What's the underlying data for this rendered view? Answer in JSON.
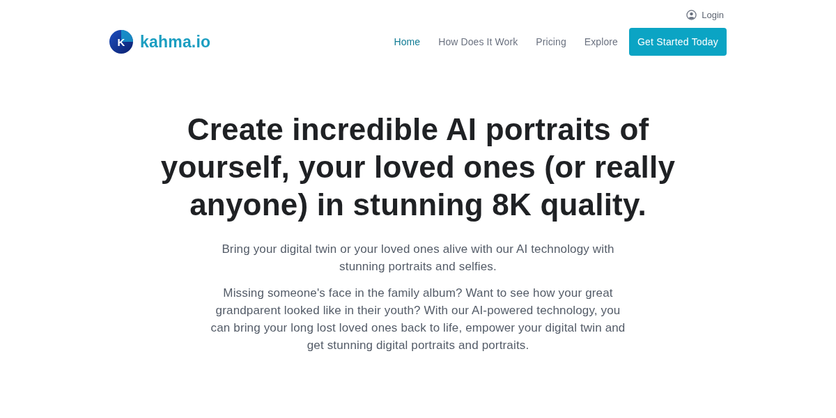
{
  "top_bar": {
    "login": "Login"
  },
  "header": {
    "logo": {
      "letter": "K",
      "name": "kahma.io"
    },
    "nav": [
      {
        "label": "Home",
        "selected": true
      },
      {
        "label": "How Does It Work",
        "selected": false
      },
      {
        "label": "Pricing",
        "selected": false
      },
      {
        "label": "Explore",
        "selected": false
      }
    ],
    "cta": "Get Started Today"
  },
  "hero": {
    "title": "Create incredible AI portraits of yourself, your loved ones (or really anyone) in stunning 8K quality.",
    "paragraphs": [
      "Bring your digital twin or your loved ones alive with our AI technology with stunning portraits and selfies.",
      "Missing someone's face in the family album? Want to see how your great grandparent looked like in their youth? With our AI-powered technology, you can bring your long lost loved ones back to life, empower your digital twin and get stunning digital portraits and portraits."
    ]
  }
}
